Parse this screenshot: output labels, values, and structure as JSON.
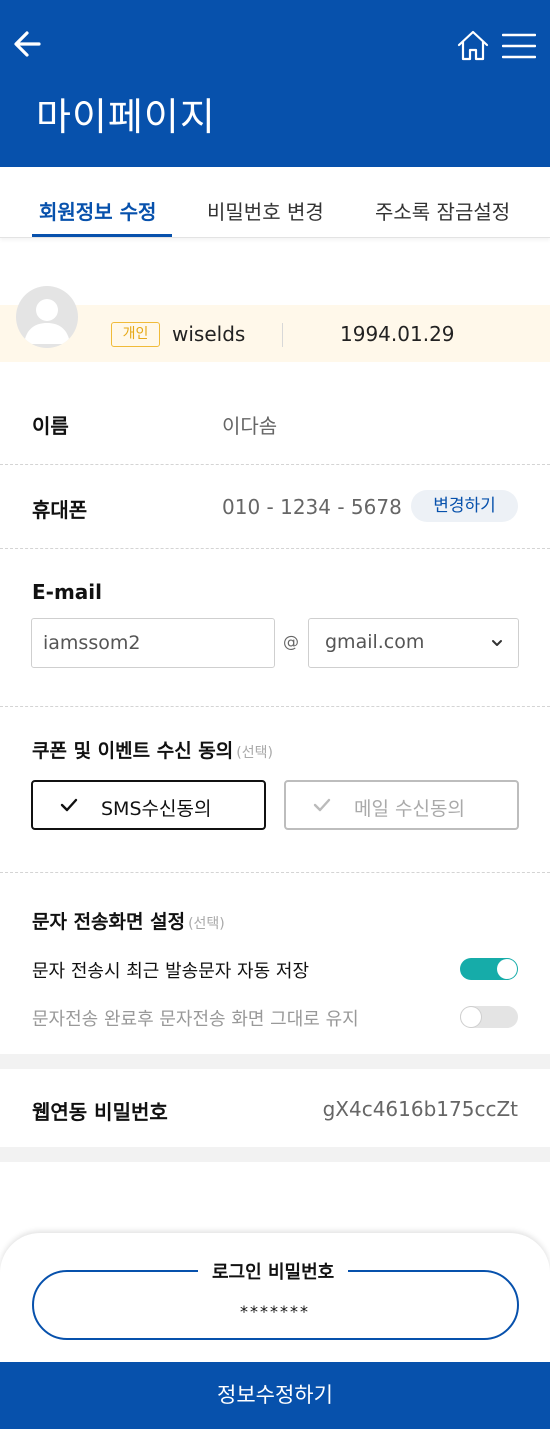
{
  "header": {
    "title": "마이페이지",
    "back_icon": "arrow-left-icon",
    "home_icon": "home-icon",
    "menu_icon": "hamburger-menu-icon",
    "color": "#0751ac"
  },
  "tabs": [
    {
      "label": "회원정보 수정",
      "active": true
    },
    {
      "label": "비밀번호 변경",
      "active": false
    },
    {
      "label": "주소록 잠금설정",
      "active": false
    }
  ],
  "profile": {
    "badge": "개인",
    "user_id": "wiselds",
    "birth": "1994.01.29"
  },
  "name_row": {
    "label": "이름",
    "value": "이다솜"
  },
  "phone_row": {
    "label": "휴대폰",
    "value": "010 - 1234 - 5678",
    "button": "변경하기"
  },
  "email": {
    "label": "E-mail",
    "local": "iamssom2",
    "at": "@",
    "domain": "gmail.com"
  },
  "consent": {
    "title": "쿠폰 및 이벤트 수신 동의",
    "optional": "(선택)",
    "sms": {
      "label": "SMS수신동의",
      "checked": true
    },
    "mail": {
      "label": "메일 수신동의",
      "checked": false
    }
  },
  "sms_screen": {
    "title": "문자 전송화면 설정",
    "optional": "(선택)",
    "options": [
      {
        "label": "문자 전송시 최근 발송문자 자동 저장",
        "on": true
      },
      {
        "label": "문자전송 완료후 문자전송 화면 그대로 유지",
        "on": false
      }
    ]
  },
  "webfax": {
    "label": "웹연동 비밀번호",
    "value": "gX4c4616b175ccZt"
  },
  "login_password": {
    "label": "로그인 비밀번호",
    "value": "*******"
  },
  "submit_label": "정보수정하기",
  "colors": {
    "accent": "#0751ac",
    "toggle_on": "#16aca9",
    "badge": "#f0bb3a"
  }
}
